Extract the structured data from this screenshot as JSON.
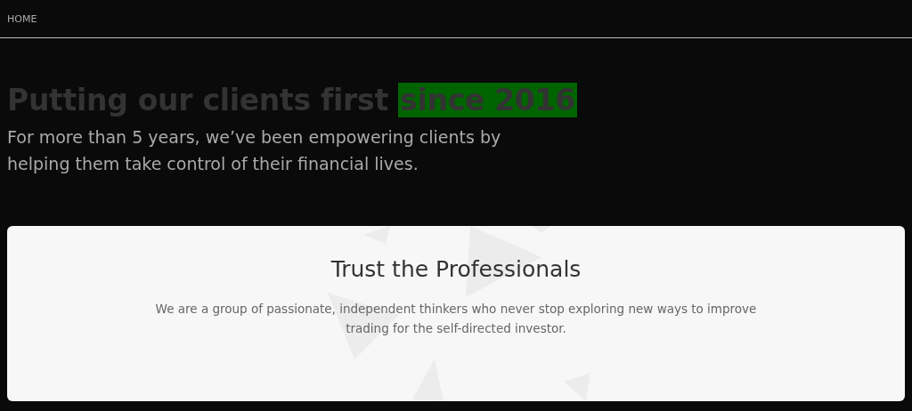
{
  "nav": {
    "label": "HOME"
  },
  "hero": {
    "title": "Putting our clients first",
    "title_highlight": "since 2016",
    "text": "For more than 5 years, we’ve been empowering clients by helping them take control of their financial lives."
  },
  "card": {
    "title": "Trust the Professionals",
    "text": "We are a group of passionate, independent thinkers who never stop exploring new ways to improve trading for the self-directed investor."
  }
}
